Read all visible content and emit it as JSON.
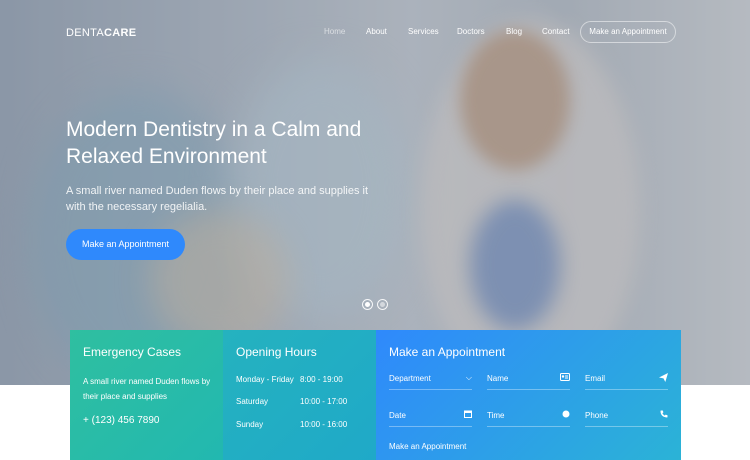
{
  "brand": {
    "regular": "DENTA",
    "bold": "CARE"
  },
  "nav": {
    "items": [
      "Home",
      "About",
      "Services",
      "Doctors",
      "Blog",
      "Contact"
    ],
    "cta": "Make an Appointment"
  },
  "hero": {
    "title": "Modern Dentistry in a Calm and Relaxed Environment",
    "subtitle": "A small river named Duden flows by their place and supplies it with the necessary regelialia.",
    "button": "Make an Appointment",
    "slide_count": 2,
    "active_slide": 1
  },
  "emergency": {
    "title": "Emergency Cases",
    "text": "A small river named Duden flows by their place and supplies",
    "phone": "+ (123) 456 7890"
  },
  "hours": {
    "title": "Opening Hours",
    "rows": [
      {
        "day": "Monday - Friday",
        "time": "8:00 - 19:00"
      },
      {
        "day": "Saturday",
        "time": "10:00 - 17:00"
      },
      {
        "day": "Sunday",
        "time": "10:00 - 16:00"
      }
    ]
  },
  "appointment": {
    "title": "Make an Appointment",
    "fields": {
      "department": "Department",
      "name": "Name",
      "email": "Email",
      "date": "Date",
      "time": "Time",
      "phone": "Phone"
    },
    "submit": "Make an Appointment"
  },
  "icons": {
    "department": "chevron-down-icon",
    "name": "id-card-icon",
    "email": "paper-plane-icon",
    "date": "calendar-icon",
    "time": "clock-icon",
    "phone": "phone-icon"
  },
  "colors": {
    "accent": "#2f89fc",
    "emergency_panel": "#2fbfa0",
    "hours_panel": "#25b2bf",
    "appointment_panel": "#2f89fc"
  }
}
